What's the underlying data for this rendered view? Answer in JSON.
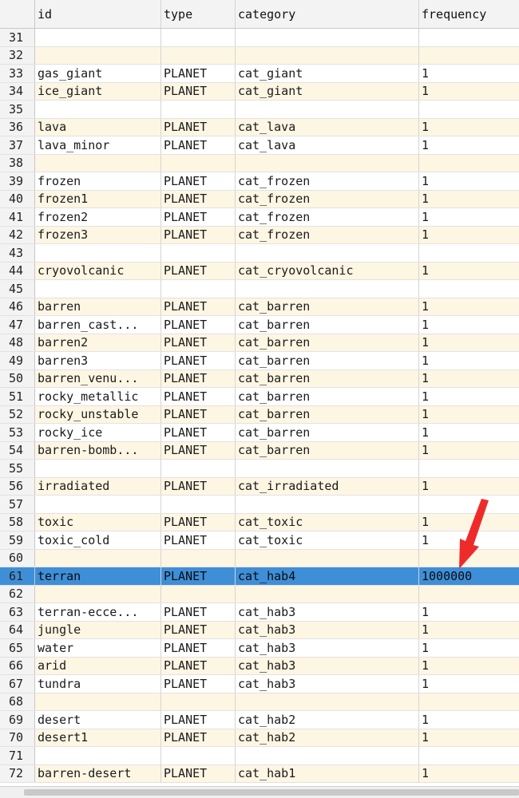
{
  "columns": [
    "id",
    "type",
    "category",
    "frequency"
  ],
  "rows": [
    {
      "n": "31",
      "id": "",
      "type": "",
      "category": "",
      "frequency": ""
    },
    {
      "n": "32",
      "id": "",
      "type": "",
      "category": "",
      "frequency": ""
    },
    {
      "n": "33",
      "id": "gas_giant",
      "type": "PLANET",
      "category": "cat_giant",
      "frequency": "1"
    },
    {
      "n": "34",
      "id": "ice_giant",
      "type": "PLANET",
      "category": "cat_giant",
      "frequency": "1"
    },
    {
      "n": "35",
      "id": "",
      "type": "",
      "category": "",
      "frequency": ""
    },
    {
      "n": "36",
      "id": "lava",
      "type": "PLANET",
      "category": "cat_lava",
      "frequency": "1"
    },
    {
      "n": "37",
      "id": "lava_minor",
      "type": "PLANET",
      "category": "cat_lava",
      "frequency": "1"
    },
    {
      "n": "38",
      "id": "",
      "type": "",
      "category": "",
      "frequency": ""
    },
    {
      "n": "39",
      "id": "frozen",
      "type": "PLANET",
      "category": "cat_frozen",
      "frequency": "1"
    },
    {
      "n": "40",
      "id": "frozen1",
      "type": "PLANET",
      "category": "cat_frozen",
      "frequency": "1"
    },
    {
      "n": "41",
      "id": "frozen2",
      "type": "PLANET",
      "category": "cat_frozen",
      "frequency": "1"
    },
    {
      "n": "42",
      "id": "frozen3",
      "type": "PLANET",
      "category": "cat_frozen",
      "frequency": "1"
    },
    {
      "n": "43",
      "id": "",
      "type": "",
      "category": "",
      "frequency": ""
    },
    {
      "n": "44",
      "id": "cryovolcanic",
      "type": "PLANET",
      "category": "cat_cryovolcanic",
      "frequency": "1"
    },
    {
      "n": "45",
      "id": "",
      "type": "",
      "category": "",
      "frequency": ""
    },
    {
      "n": "46",
      "id": "barren",
      "type": "PLANET",
      "category": "cat_barren",
      "frequency": "1"
    },
    {
      "n": "47",
      "id": "barren_cast...",
      "type": "PLANET",
      "category": "cat_barren",
      "frequency": "1"
    },
    {
      "n": "48",
      "id": "barren2",
      "type": "PLANET",
      "category": "cat_barren",
      "frequency": "1"
    },
    {
      "n": "49",
      "id": "barren3",
      "type": "PLANET",
      "category": "cat_barren",
      "frequency": "1"
    },
    {
      "n": "50",
      "id": "barren_venu...",
      "type": "PLANET",
      "category": "cat_barren",
      "frequency": "1"
    },
    {
      "n": "51",
      "id": "rocky_metallic",
      "type": "PLANET",
      "category": "cat_barren",
      "frequency": "1"
    },
    {
      "n": "52",
      "id": "rocky_unstable",
      "type": "PLANET",
      "category": "cat_barren",
      "frequency": "1"
    },
    {
      "n": "53",
      "id": "rocky_ice",
      "type": "PLANET",
      "category": "cat_barren",
      "frequency": "1"
    },
    {
      "n": "54",
      "id": "barren-bomb...",
      "type": "PLANET",
      "category": "cat_barren",
      "frequency": "1"
    },
    {
      "n": "55",
      "id": "",
      "type": "",
      "category": "",
      "frequency": ""
    },
    {
      "n": "56",
      "id": "irradiated",
      "type": "PLANET",
      "category": "cat_irradiated",
      "frequency": "1"
    },
    {
      "n": "57",
      "id": "",
      "type": "",
      "category": "",
      "frequency": ""
    },
    {
      "n": "58",
      "id": "toxic",
      "type": "PLANET",
      "category": "cat_toxic",
      "frequency": "1"
    },
    {
      "n": "59",
      "id": "toxic_cold",
      "type": "PLANET",
      "category": "cat_toxic",
      "frequency": "1"
    },
    {
      "n": "60",
      "id": "",
      "type": "",
      "category": "",
      "frequency": ""
    },
    {
      "n": "61",
      "id": "terran",
      "type": "PLANET",
      "category": "cat_hab4",
      "frequency": "1000000",
      "selected": true
    },
    {
      "n": "62",
      "id": "",
      "type": "",
      "category": "",
      "frequency": ""
    },
    {
      "n": "63",
      "id": "terran-ecce...",
      "type": "PLANET",
      "category": "cat_hab3",
      "frequency": "1"
    },
    {
      "n": "64",
      "id": "jungle",
      "type": "PLANET",
      "category": "cat_hab3",
      "frequency": "1"
    },
    {
      "n": "65",
      "id": "water",
      "type": "PLANET",
      "category": "cat_hab3",
      "frequency": "1"
    },
    {
      "n": "66",
      "id": "arid",
      "type": "PLANET",
      "category": "cat_hab3",
      "frequency": "1"
    },
    {
      "n": "67",
      "id": "tundra",
      "type": "PLANET",
      "category": "cat_hab3",
      "frequency": "1"
    },
    {
      "n": "68",
      "id": "",
      "type": "",
      "category": "",
      "frequency": ""
    },
    {
      "n": "69",
      "id": "desert",
      "type": "PLANET",
      "category": "cat_hab2",
      "frequency": "1"
    },
    {
      "n": "70",
      "id": "desert1",
      "type": "PLANET",
      "category": "cat_hab2",
      "frequency": "1"
    },
    {
      "n": "71",
      "id": "",
      "type": "",
      "category": "",
      "frequency": ""
    },
    {
      "n": "72",
      "id": "barren-desert",
      "type": "PLANET",
      "category": "cat_hab1",
      "frequency": "1"
    }
  ],
  "colors": {
    "selected_row": "#3f8fd8",
    "alt_row": "#fdf6e3",
    "annotation_arrow": "#ee2b2b"
  },
  "icons": {
    "annotation": "red-arrow-icon"
  }
}
